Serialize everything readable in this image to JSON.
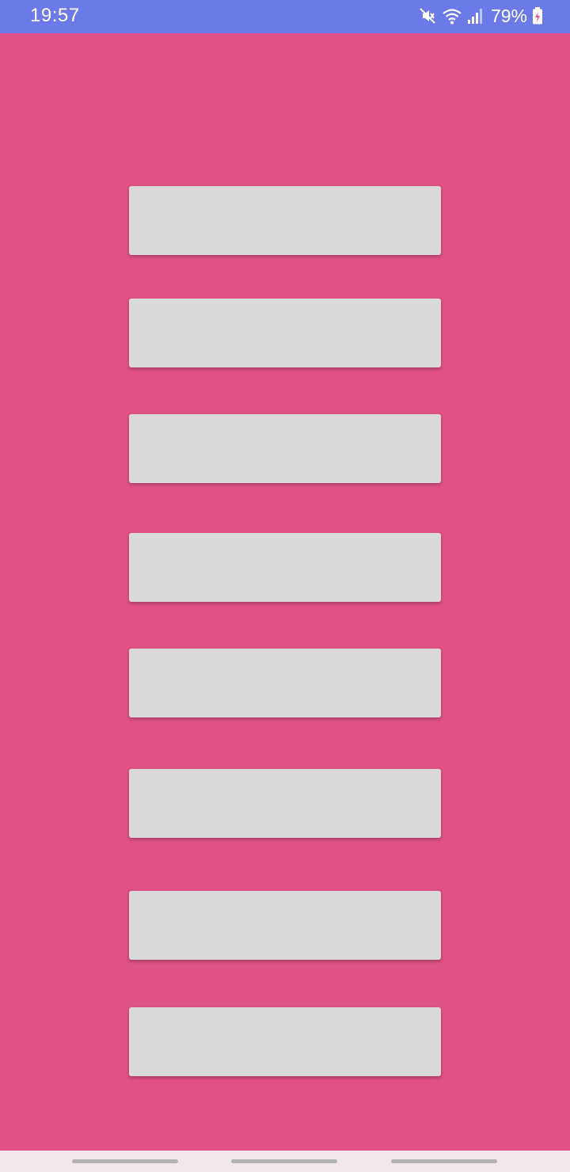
{
  "status_bar": {
    "time": "19:57",
    "battery": "79%",
    "icons": [
      "mute-icon",
      "wifi-icon",
      "signal-icon",
      "battery-charging-icon"
    ]
  },
  "title": "",
  "buttons": [
    {
      "label": ""
    },
    {
      "label": ""
    },
    {
      "label": ""
    },
    {
      "label": ""
    },
    {
      "label": ""
    },
    {
      "label": ""
    },
    {
      "label": ""
    },
    {
      "label": ""
    }
  ],
  "colors": {
    "background": "#e05185",
    "status_bar": "#6b7ae8",
    "button": "#d9d9d9",
    "nav_bar": "#f3e7ee"
  }
}
